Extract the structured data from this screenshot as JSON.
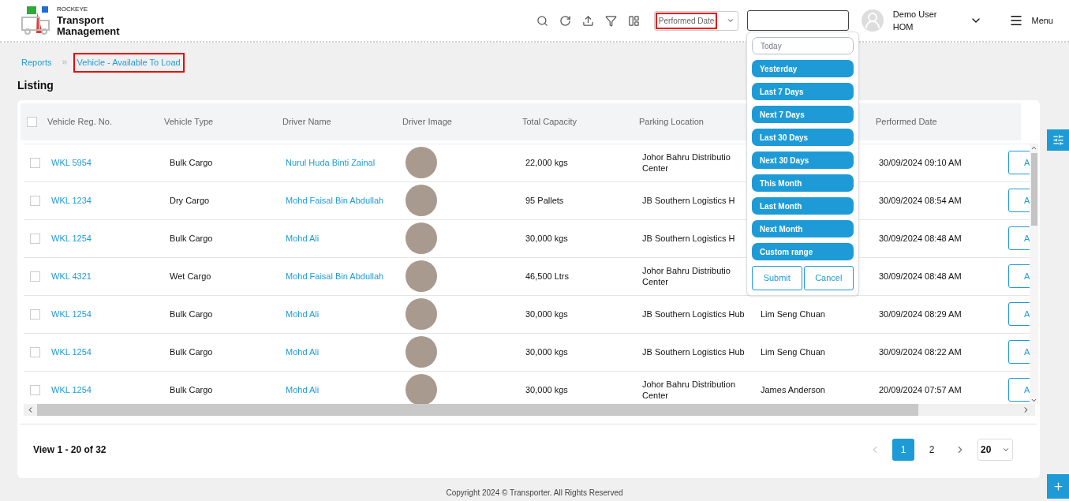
{
  "brand": {
    "small": "ROCKEYE",
    "title_line1": "Transport",
    "title_line2": "Management"
  },
  "date_field": {
    "label": "Performed Date",
    "highlighted": true
  },
  "user": {
    "name": "Demo User",
    "org": "HOM"
  },
  "menu_label": "Menu",
  "breadcrumb": [
    {
      "label": "Reports",
      "highlighted": false
    },
    {
      "label": "Vehicle - Available To Load",
      "highlighted": true
    }
  ],
  "page_title": "Listing",
  "table": {
    "select_all_checked": false,
    "columns": [
      "Vehicle Reg. No.",
      "Vehicle Type",
      "Driver Name",
      "Driver Image",
      "Total Capacity",
      "Parking Location",
      "Performed Date"
    ],
    "rows": [
      {
        "checked": false,
        "reg": "WKL 5954",
        "type": "Bulk Cargo",
        "driver": "Nurul Huda Binti Zainal",
        "capacity": "22,000 kgs",
        "parking": [
          "Johor Bahru Distributio",
          "Center"
        ],
        "date": "30/09/2024 09:10 AM",
        "action": "A"
      },
      {
        "checked": false,
        "reg": "WKL 1234",
        "type": "Dry Cargo",
        "driver": "Mohd Faisal Bin Abdullah",
        "capacity": "95 Pallets",
        "parking": [
          "JB Southern Logistics H"
        ],
        "date": "30/09/2024 08:54 AM",
        "action": "A"
      },
      {
        "checked": false,
        "reg": "WKL 1254",
        "type": "Bulk Cargo",
        "driver": "Mohd Ali",
        "capacity": "30,000 kgs",
        "parking": [
          "JB Southern Logistics H"
        ],
        "date": "30/09/2024 08:48 AM",
        "action": "A"
      },
      {
        "checked": false,
        "reg": "WKL 4321",
        "type": "Wet Cargo",
        "driver": "Mohd Faisal Bin Abdullah",
        "capacity": "46,500 Ltrs",
        "parking": [
          "Johor Bahru Distributio",
          "Center"
        ],
        "date": "30/09/2024 08:48 AM",
        "action": "A"
      },
      {
        "checked": false,
        "reg": "WKL 1254",
        "type": "Bulk Cargo",
        "driver": "Mohd Ali",
        "capacity": "30,000 kgs",
        "parking": [
          "JB Southern Logistics Hub"
        ],
        "column_7": "Lim Seng Chuan",
        "date": "30/09/2024 08:29 AM",
        "action": "A"
      },
      {
        "checked": false,
        "reg": "WKL 1254",
        "type": "Bulk Cargo",
        "driver": "Mohd Ali",
        "capacity": "30,000 kgs",
        "parking": [
          "JB Southern Logistics Hub"
        ],
        "column_7": "Lim Seng Chuan",
        "date": "30/09/2024 08:22 AM",
        "action": "A"
      },
      {
        "checked": false,
        "reg": "WKL 1254",
        "type": "Bulk Cargo",
        "driver": "Mohd Ali",
        "capacity": "30,000 kgs",
        "parking": [
          "Johor Bahru Distribution",
          "Center"
        ],
        "column_7": "James Anderson",
        "date": "20/09/2024 07:57 AM",
        "action": "A"
      }
    ]
  },
  "date_ranges": [
    {
      "label": "Today",
      "selected": true
    },
    {
      "label": "Yesterday",
      "selected": false
    },
    {
      "label": "Last 7 Days",
      "selected": false
    },
    {
      "label": "Next 7 Days",
      "selected": false
    },
    {
      "label": "Last 30 Days",
      "selected": false
    },
    {
      "label": "Next 30 Days",
      "selected": false
    },
    {
      "label": "This Month",
      "selected": false
    },
    {
      "label": "Last Month",
      "selected": false
    },
    {
      "label": "Next Month",
      "selected": false
    },
    {
      "label": "Custom range",
      "selected": false
    }
  ],
  "range_buttons": [
    "Submit",
    "Cancel"
  ],
  "footer": {
    "summary": "View 1 - 20 of 32",
    "pages": [
      {
        "label": "1",
        "selected": true
      },
      {
        "label": "2",
        "selected": false
      }
    ],
    "prev_disabled": true,
    "page_size": "20"
  },
  "copyright": "Copyright 2024 © Transporter. All Rights Reserved"
}
